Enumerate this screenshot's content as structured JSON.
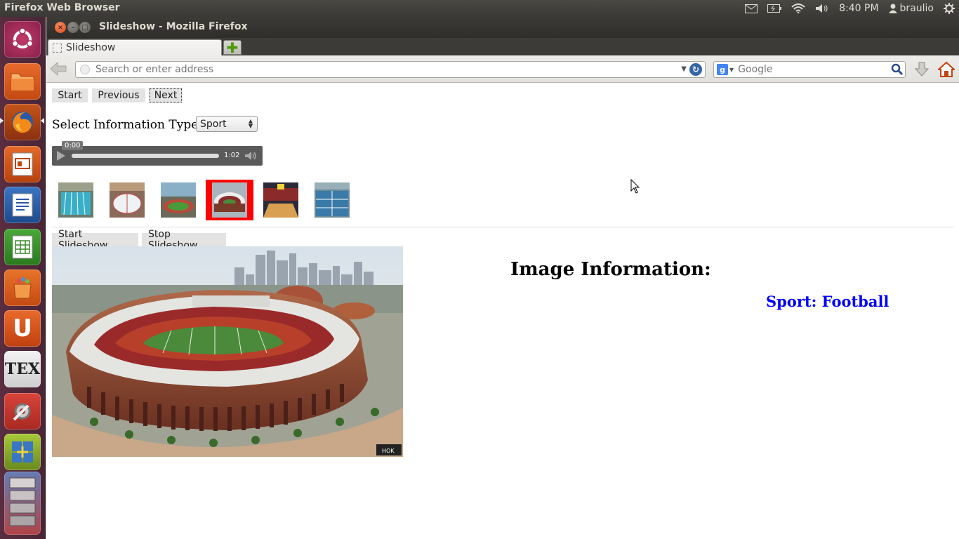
{
  "top_panel": {
    "app_title": "Firefox Web Browser",
    "time": "8:40 PM",
    "user": "braulio",
    "icons": [
      "mail-icon",
      "battery-icon",
      "wifi-icon",
      "volume-icon",
      "user-icon",
      "gear-icon"
    ]
  },
  "launcher": {
    "items": [
      "ubuntu-dash",
      "files",
      "firefox",
      "impress",
      "writer",
      "calc",
      "software-center",
      "ubuntu-one",
      "texmaker",
      "system-settings",
      "workspace-switcher",
      "stacked-apps"
    ]
  },
  "window": {
    "title": "Slideshow - Mozilla Firefox",
    "tab_label": "Slideshow",
    "url_placeholder": "Search or enter address",
    "search_placeholder": "Google"
  },
  "page": {
    "nav_buttons": {
      "start": "Start",
      "previous": "Previous",
      "next": "Next"
    },
    "select_label": "Select Information Type:",
    "select_value": "Sport",
    "audio": {
      "current_time": "0:00",
      "duration": "1:02"
    },
    "thumbnails": [
      {
        "name": "pool",
        "selected": false
      },
      {
        "name": "ice-rink",
        "selected": false
      },
      {
        "name": "track",
        "selected": false
      },
      {
        "name": "football-stadium",
        "selected": true
      },
      {
        "name": "basketball-arena",
        "selected": false
      },
      {
        "name": "tennis-courts",
        "selected": false
      }
    ],
    "slideshow_buttons": {
      "start": "Start Slideshow",
      "stop": "Stop Slideshow"
    },
    "info_heading": "Image Information:",
    "info_value": "Sport: Football",
    "image_watermark": "HOK"
  },
  "colors": {
    "selected_thumb_border": "#ff0000",
    "info_value": "#0000ff",
    "launcher_bg": "#5a2d40",
    "panel_bg": "#3c3b37"
  }
}
